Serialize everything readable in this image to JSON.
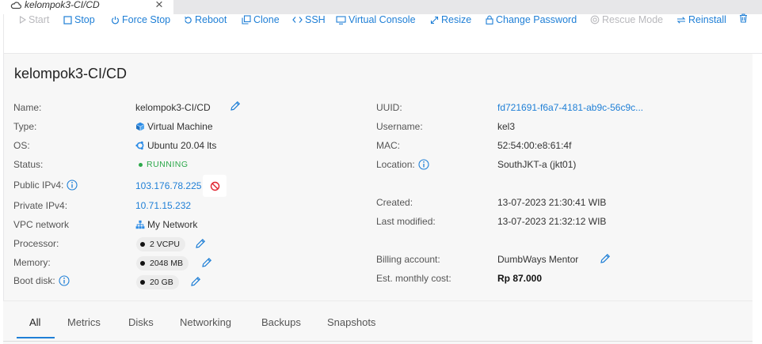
{
  "window_tab": {
    "title": "kelompok3-CI/CD",
    "close": "×",
    "icon": "cloud-icon"
  },
  "toolbar": {
    "start": "Start",
    "stop": "Stop",
    "force_stop": "Force Stop",
    "reboot": "Reboot",
    "clone": "Clone",
    "ssh": "SSH",
    "virtual_console": "Virtual Console",
    "resize": "Resize",
    "change_password": "Change Password",
    "rescue_mode": "Rescue Mode",
    "reinstall": "Reinstall",
    "delete_icon": "trash-icon"
  },
  "vm": {
    "title": "kelompok3-CI/CD",
    "left": {
      "name_label": "Name:",
      "name": "kelompok3-CI/CD",
      "type_label": "Type:",
      "type": "Virtual Machine",
      "os_label": "OS:",
      "os": "Ubuntu 20.04 lts",
      "status_label": "Status:",
      "status": "RUNNING",
      "public_ipv4_label": "Public IPv4:",
      "public_ipv4": "103.176.78.225",
      "private_ipv4_label": "Private IPv4:",
      "private_ipv4": "10.71.15.232",
      "vpc_label": "VPC network",
      "vpc": "My Network",
      "processor_label": "Processor:",
      "processor": "2 VCPU",
      "memory_label": "Memory:",
      "memory": "2048 MB",
      "boot_disk_label": "Boot disk:",
      "boot_disk": "20 GB"
    },
    "right": {
      "uuid_label": "UUID:",
      "uuid": "fd721691-f6a7-4181-ab9c-56c9c...",
      "username_label": "Username:",
      "username": "kel3",
      "mac_label": "MAC:",
      "mac": "52:54:00:e8:61:4f",
      "location_label": "Location:",
      "location": "SouthJKT-a (jkt01)",
      "created_label": "Created:",
      "created": "13-07-2023 21:30:41 WIB",
      "modified_label": "Last modified:",
      "modified": "13-07-2023 21:32:12 WIB",
      "billing_label": "Billing account:",
      "billing": "DumbWays Mentor",
      "cost_label": "Est. monthly cost:",
      "cost": "Rp 87.000"
    }
  },
  "detail_tabs": [
    "All",
    "Metrics",
    "Disks",
    "Networking",
    "Backups",
    "Snapshots"
  ],
  "colors": {
    "accent": "#1f7fd6",
    "running": "#2ca84a",
    "danger": "#e0242f",
    "disabled": "#b9b9bd"
  }
}
